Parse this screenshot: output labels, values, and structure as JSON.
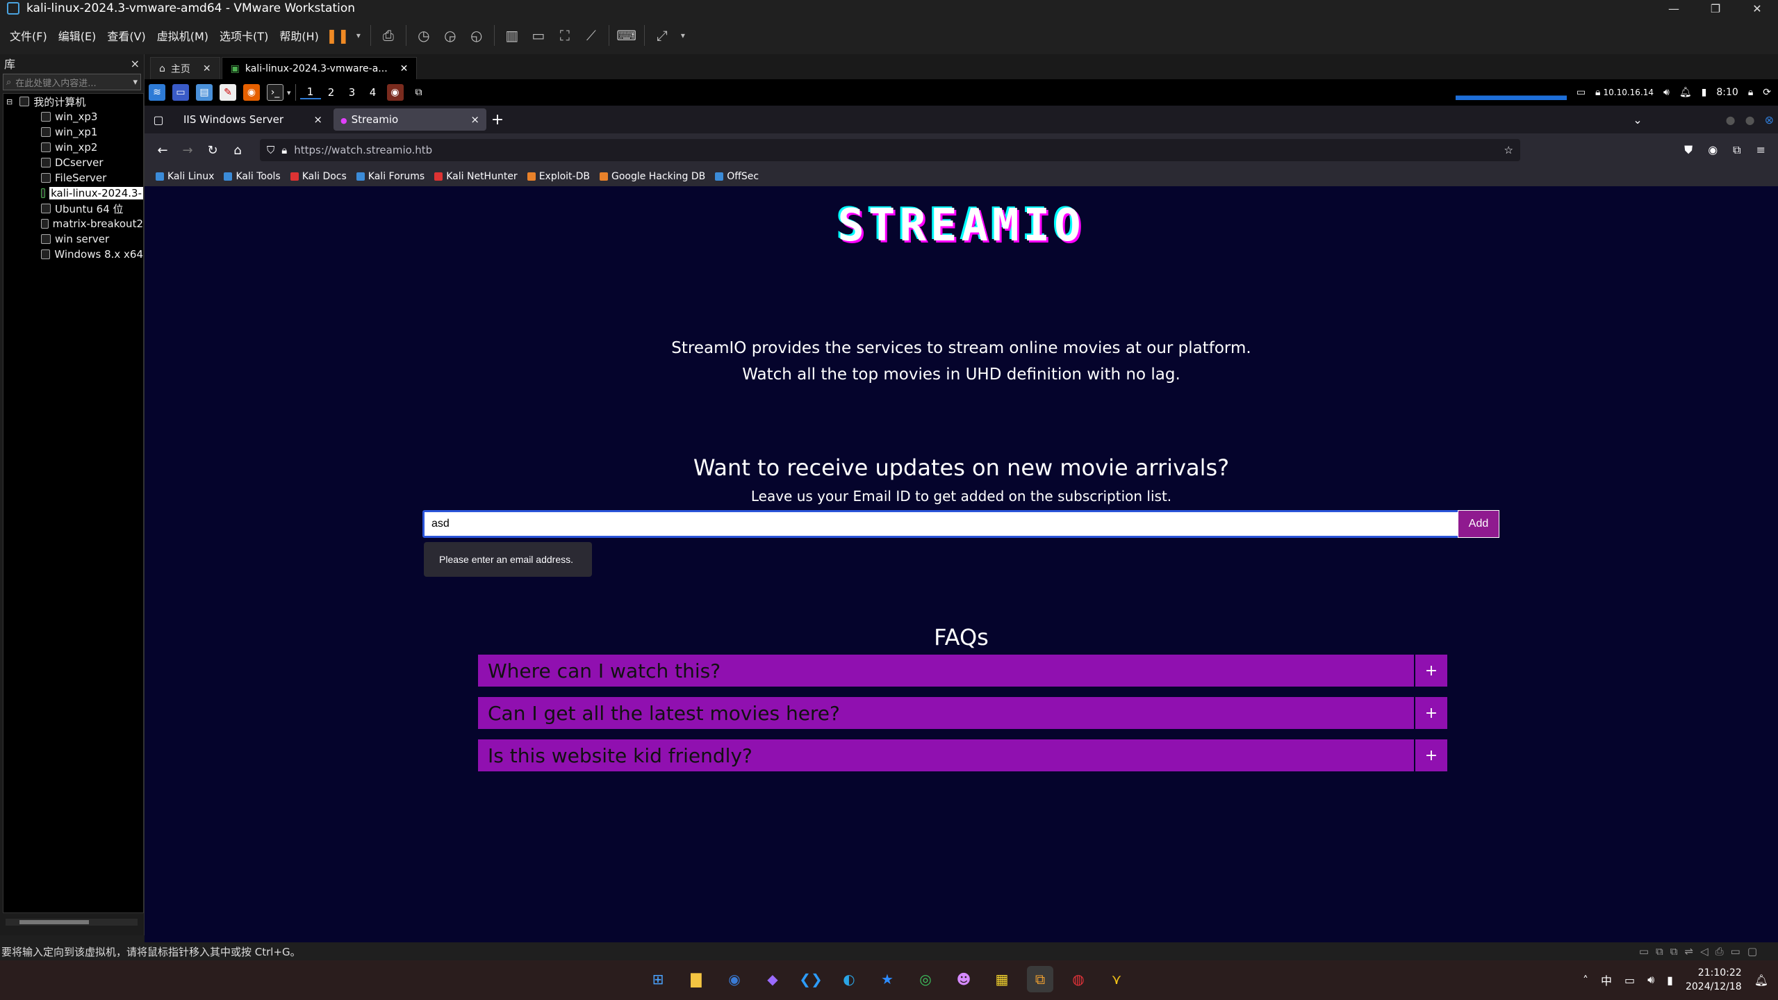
{
  "window": {
    "title": "kali-linux-2024.3-vmware-amd64 - VMware Workstation",
    "controls": [
      "—",
      "❐",
      "✕"
    ]
  },
  "menubar": {
    "items": [
      "文件(F)",
      "编辑(E)",
      "查看(V)",
      "虚拟机(M)",
      "选项卡(T)",
      "帮助(H)"
    ]
  },
  "library": {
    "title": "库",
    "close": "×",
    "search_placeholder": "在此处键入内容进...",
    "root": "我的计算机",
    "vms": [
      "win_xp3",
      "win_xp1",
      "win_xp2",
      "DCserver",
      "FileServer",
      "kali-linux-2024.3-",
      "Ubuntu 64 位",
      "matrix-breakout2",
      "win server",
      "Windows 8.x x64"
    ],
    "selected_index": 5
  },
  "vm_tabs": [
    {
      "label": "主页",
      "close": "✕"
    },
    {
      "label": "kali-linux-2024.3-vmware-a...",
      "close": "✕"
    }
  ],
  "kali_panel": {
    "workspaces": [
      "1",
      "2",
      "3",
      "4"
    ],
    "ip": "10.10.16.14",
    "time": "8:10"
  },
  "browser": {
    "tabs": [
      {
        "label": "IIS Windows Server",
        "close": "×"
      },
      {
        "label": "Streamio",
        "close": "×"
      }
    ],
    "newtab": "+",
    "url": "https://watch.streamio.htb",
    "bookmarks": [
      {
        "label": "Kali Linux",
        "color": "#3b8bd8"
      },
      {
        "label": "Kali Tools",
        "color": "#3b8bd8"
      },
      {
        "label": "Kali Docs",
        "color": "#d33"
      },
      {
        "label": "Kali Forums",
        "color": "#3b8bd8"
      },
      {
        "label": "Kali NetHunter",
        "color": "#d33"
      },
      {
        "label": "Exploit-DB",
        "color": "#e8812a"
      },
      {
        "label": "Google Hacking DB",
        "color": "#e8812a"
      },
      {
        "label": "OffSec",
        "color": "#3b8bd8"
      }
    ]
  },
  "page": {
    "logo": "STREAMIO",
    "intro_line1": "StreamIO provides the services to stream online movies at our platform.",
    "intro_line2": "Watch all the top movies in UHD definition with no lag.",
    "subscribe_heading": "Want to receive updates on new movie arrivals?",
    "subscribe_text": "Leave us your Email ID to get added on the subscription list.",
    "email_value": "asd",
    "add_label": "Add",
    "validation_tooltip": "Please enter an email address.",
    "faq_title": "FAQs",
    "faqs": [
      {
        "q": "Where can I watch this?",
        "toggle": "+"
      },
      {
        "q": "Can I get all the latest movies here?",
        "toggle": "+"
      },
      {
        "q": "Is this website kid friendly?",
        "toggle": "+"
      }
    ],
    "accent": "#9010b0",
    "background": "#05042c"
  },
  "statusbar": {
    "text": "要将输入定向到该虚拟机，请将鼠标指针移入其中或按 Ctrl+G。"
  },
  "taskbar": {
    "ime": "中",
    "time": "21:10:22",
    "date": "2024/12/18"
  }
}
